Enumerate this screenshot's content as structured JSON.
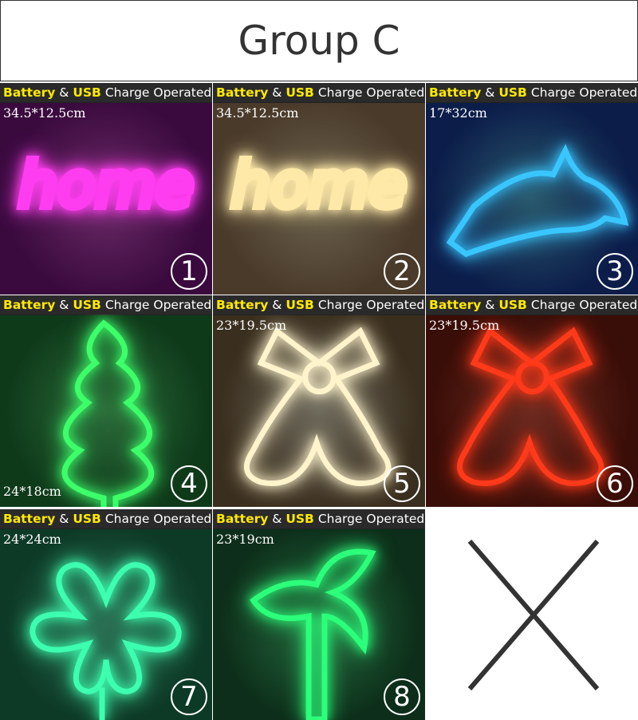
{
  "title": "Group C",
  "banner": {
    "battery": "Battery",
    "amp": " & ",
    "usb": "USB",
    "rest": " Charge Operated"
  },
  "products": [
    {
      "number": "1",
      "size": "34.5*12.5cm",
      "shape": "home",
      "color": "#ff3df0",
      "bg": "#3a0a3e"
    },
    {
      "number": "2",
      "size": "34.5*12.5cm",
      "shape": "home",
      "color": "#ffe9a8",
      "bg": "#4a3a2a"
    },
    {
      "number": "3",
      "size": "17*32cm",
      "shape": "dolphin",
      "color": "#39c6ff",
      "bg": "#0c1d4a"
    },
    {
      "number": "4",
      "size": "24*18cm",
      "shape": "tree",
      "color": "#3dff6a",
      "bg": "#0f3a1a"
    },
    {
      "number": "5",
      "size": "23*19.5cm",
      "shape": "bells",
      "color": "#fff4cc",
      "bg": "#3a2e1e"
    },
    {
      "number": "6",
      "size": "23*19.5cm",
      "shape": "bells",
      "color": "#ff3a1a",
      "bg": "#3a0e08"
    },
    {
      "number": "7",
      "size": "24*24cm",
      "shape": "clover",
      "color": "#3dffb0",
      "bg": "#0d3a26"
    },
    {
      "number": "8",
      "size": "23*19cm",
      "shape": "palm",
      "color": "#2cff7a",
      "bg": "#0d2e1a"
    }
  ]
}
